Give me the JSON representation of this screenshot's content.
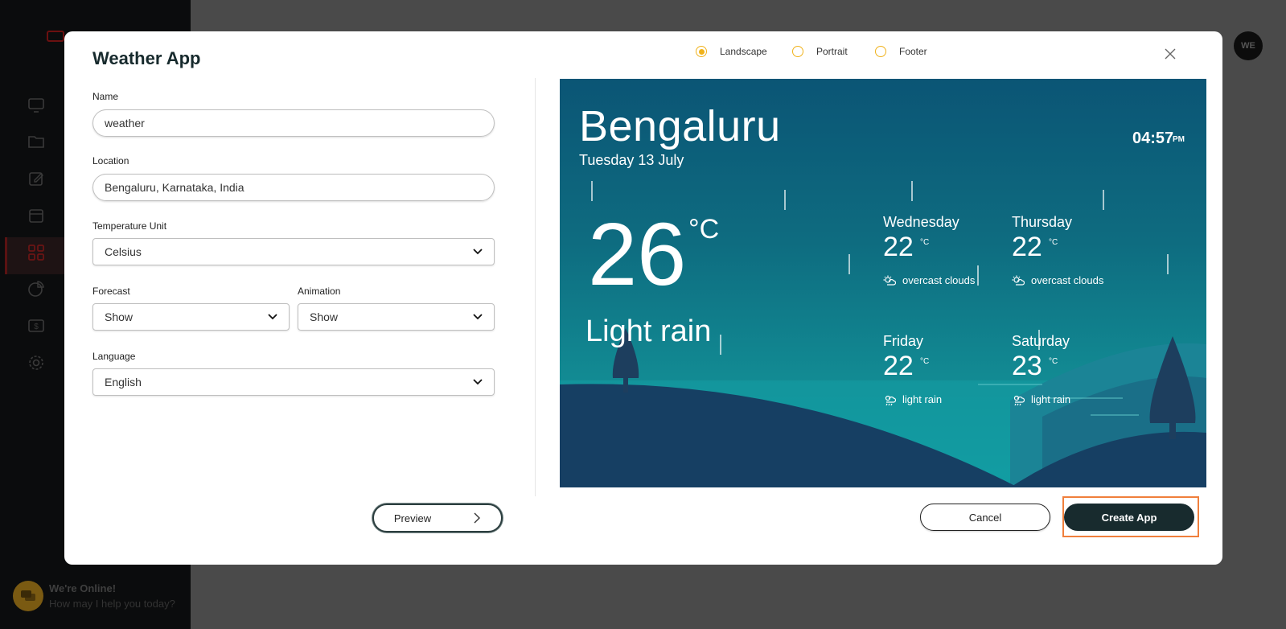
{
  "background": {
    "avatar_initials": "WE",
    "chat": {
      "title": "We're Online!",
      "subtitle": "How may I help you today?"
    }
  },
  "modal": {
    "title": "Weather App",
    "orientation": {
      "options": [
        "Landscape",
        "Portrait",
        "Footer"
      ],
      "selected": "Landscape"
    },
    "form": {
      "name": {
        "label": "Name",
        "value": "weather"
      },
      "location": {
        "label": "Location",
        "value": "Bengaluru, Karnataka, India"
      },
      "temperature_unit": {
        "label": "Temperature Unit",
        "value": "Celsius"
      },
      "forecast": {
        "label": "Forecast",
        "value": "Show"
      },
      "animation": {
        "label": "Animation",
        "value": "Show"
      },
      "language": {
        "label": "Language",
        "value": "English"
      }
    },
    "preview_button": "Preview",
    "cancel_button": "Cancel",
    "create_button": "Create App"
  },
  "weather_preview": {
    "city": "Bengaluru",
    "date": "Tuesday 13 July",
    "time": "04:57",
    "ampm": "PM",
    "temperature": "26",
    "unit": "°C",
    "condition": "Light rain",
    "forecast": [
      {
        "day": "Wednesday",
        "temp": "22",
        "unit": "°C",
        "desc": "overcast clouds",
        "icon": "cloudy-sun-icon"
      },
      {
        "day": "Thursday",
        "temp": "22",
        "unit": "°C",
        "desc": "overcast clouds",
        "icon": "cloudy-sun-icon"
      },
      {
        "day": "Friday",
        "temp": "22",
        "unit": "°C",
        "desc": "light rain",
        "icon": "rain-cloud-icon"
      },
      {
        "day": "Saturday",
        "temp": "23",
        "unit": "°C",
        "desc": "light rain",
        "icon": "rain-cloud-icon"
      }
    ],
    "colors": {
      "sky_top": "#0b5575",
      "sky_bottom": "#0f9aa0",
      "hill_dark": "#153e62",
      "accent_radio": "#f0b21b",
      "highlight_border": "#f07f3c",
      "primary_button": "#182b2e"
    }
  }
}
